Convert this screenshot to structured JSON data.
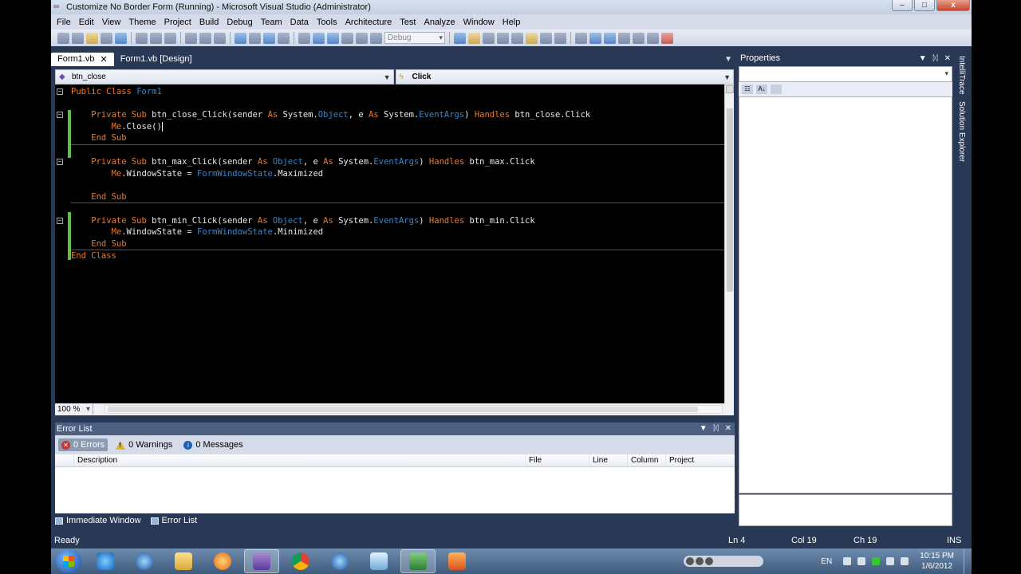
{
  "window": {
    "title": "Customize No Border Form (Running) - Microsoft Visual Studio (Administrator)",
    "controls": {
      "minimize": "–",
      "maximize": "□",
      "close": "x"
    }
  },
  "menu": [
    "File",
    "Edit",
    "View",
    "Theme",
    "Project",
    "Build",
    "Debug",
    "Team",
    "Data",
    "Tools",
    "Architecture",
    "Test",
    "Analyze",
    "Window",
    "Help"
  ],
  "toolbar": {
    "config": "Debug"
  },
  "tabs": [
    {
      "label": "Form1.vb",
      "active": true,
      "close": "✕"
    },
    {
      "label": "Form1.vb [Design]",
      "active": false
    }
  ],
  "navbar": {
    "object": "btn_close",
    "event": "Click"
  },
  "code": [
    [
      [
        "kw",
        "Public Class "
      ],
      [
        "ty",
        "Form1"
      ]
    ],
    [],
    [
      [
        "kw",
        "    Private Sub "
      ],
      [
        "t",
        "btn_close_Click(sender "
      ],
      [
        "kw",
        "As "
      ],
      [
        "t",
        "System."
      ],
      [
        "ty",
        "Object"
      ],
      [
        "t",
        ", e "
      ],
      [
        "kw",
        "As "
      ],
      [
        "t",
        "System."
      ],
      [
        "ty",
        "EventArgs"
      ],
      [
        "t",
        ") "
      ],
      [
        "kw",
        "Handles "
      ],
      [
        "t",
        "btn_close.Click"
      ]
    ],
    [
      [
        "kw",
        "        Me"
      ],
      [
        "t",
        ".Close()"
      ]
    ],
    [
      [
        "kw",
        "    End Sub"
      ]
    ],
    [],
    [
      [
        "kw",
        "    Private Sub "
      ],
      [
        "t",
        "btn_max_Click(sender "
      ],
      [
        "kw",
        "As "
      ],
      [
        "ty",
        "Object"
      ],
      [
        "t",
        ", e "
      ],
      [
        "kw",
        "As "
      ],
      [
        "t",
        "System."
      ],
      [
        "ty",
        "EventArgs"
      ],
      [
        "t",
        ") "
      ],
      [
        "kw",
        "Handles "
      ],
      [
        "t",
        "btn_max.Click"
      ]
    ],
    [
      [
        "kw",
        "        Me"
      ],
      [
        "t",
        ".WindowState = "
      ],
      [
        "ty",
        "FormWindowState"
      ],
      [
        "t",
        ".Maximized"
      ]
    ],
    [],
    [
      [
        "kw",
        "    End Sub"
      ]
    ],
    [],
    [
      [
        "kw",
        "    Private Sub "
      ],
      [
        "t",
        "btn_min_Click(sender "
      ],
      [
        "kw",
        "As "
      ],
      [
        "ty",
        "Object"
      ],
      [
        "t",
        ", e "
      ],
      [
        "kw",
        "As "
      ],
      [
        "t",
        "System."
      ],
      [
        "ty",
        "EventArgs"
      ],
      [
        "t",
        ") "
      ],
      [
        "kw",
        "Handles "
      ],
      [
        "t",
        "btn_min.Click"
      ]
    ],
    [
      [
        "kw",
        "        Me"
      ],
      [
        "t",
        ".WindowState = "
      ],
      [
        "ty",
        "FormWindowState"
      ],
      [
        "t",
        ".Minimized"
      ]
    ],
    [
      [
        "kw",
        "    End Sub"
      ]
    ],
    [
      [
        "kw",
        "End Class"
      ]
    ]
  ],
  "editor": {
    "zoom": "100 %"
  },
  "properties": {
    "title": "Properties",
    "sort_az": "A↓"
  },
  "side_tabs": [
    "IntelliTrace",
    "Solution Explorer"
  ],
  "error_list": {
    "title": "Error List",
    "filters": {
      "errors": "0 Errors",
      "warnings": "0 Warnings",
      "messages": "0 Messages"
    },
    "columns": {
      "description": "Description",
      "file": "File",
      "line": "Line",
      "column": "Column",
      "project": "Project"
    }
  },
  "bottom_tabs": [
    "Immediate Window",
    "Error List"
  ],
  "status": {
    "text": "Ready",
    "ln": "Ln 4",
    "col": "Col 19",
    "ch": "Ch 19",
    "mode": "INS"
  },
  "taskbar": {
    "lang": "EN",
    "time": "10:15 PM",
    "date": "1/6/2012"
  },
  "colors": {
    "chrome": "#293955",
    "keyword": "#e87a2c",
    "type": "#3a86c8",
    "change_bar": "#5fbf4a"
  }
}
